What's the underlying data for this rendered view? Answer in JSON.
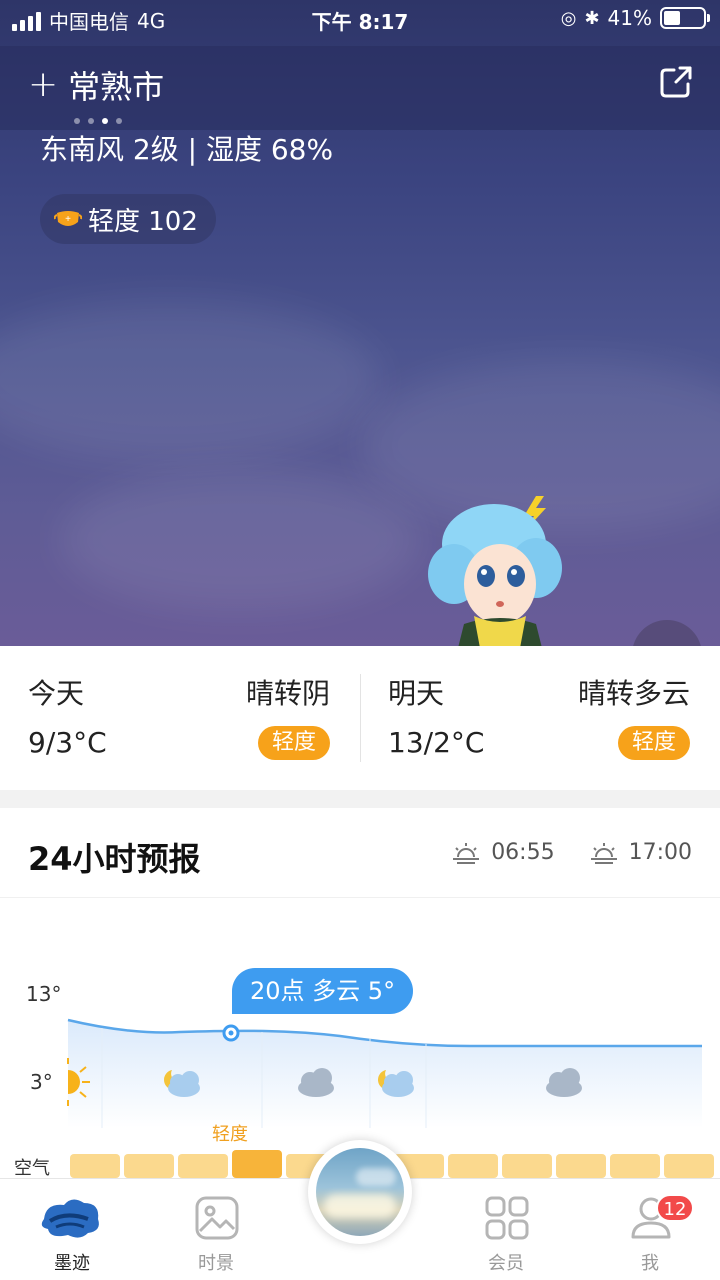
{
  "status_bar": {
    "carrier": "中国电信",
    "network": "4G",
    "time": "下午 8:17",
    "battery": "41%",
    "battery_level": 0.41
  },
  "header": {
    "add_icon": "plus-icon",
    "city": "常熟市",
    "share_icon": "share-icon",
    "page_dots": 4,
    "active_dot": 3
  },
  "current": {
    "wind_humidity": "东南风 2级 | 湿度 68%",
    "aqi_label": "轻度 102",
    "aqi_icon": "mask-icon"
  },
  "days": [
    {
      "name": "今天",
      "condition": "晴转阴",
      "temp": "9/3°C",
      "aqi": "轻度"
    },
    {
      "name": "明天",
      "condition": "晴转多云",
      "temp": "13/2°C",
      "aqi": "轻度"
    }
  ],
  "forecast": {
    "title": "24小时预报",
    "sunrise": "06:55",
    "sunset": "17:00",
    "y_max_label": "13°",
    "y_min_label": "3°",
    "tooltip": "20点 多云 5°",
    "air_label": "空气",
    "air_top_label": "轻度"
  },
  "chart_data": {
    "type": "area",
    "y_labels": [
      "13°",
      "3°"
    ],
    "ylim": [
      3,
      13
    ],
    "highlight": {
      "hour": "20点",
      "condition": "多云",
      "temp": 5
    },
    "icons": [
      "sun",
      "moon-cloud",
      "cloud",
      "moon-cloud",
      "cloud"
    ],
    "aqi_bars": 12
  },
  "colors": {
    "accent": "#3e9cf0",
    "badge": "#f7a21a",
    "sky_top": "#2e3568",
    "sky_bottom": "#6a5c98",
    "notification": "#f24a4a"
  },
  "nav": {
    "tabs": [
      {
        "label": "墨迹",
        "icon": "moji-cloud-icon",
        "active": true
      },
      {
        "label": "时景",
        "icon": "photo-icon",
        "active": false
      },
      {
        "label": "会员",
        "icon": "grid-icon",
        "active": false
      },
      {
        "label": "我",
        "icon": "user-icon",
        "active": false
      }
    ],
    "me_badge": "12"
  }
}
